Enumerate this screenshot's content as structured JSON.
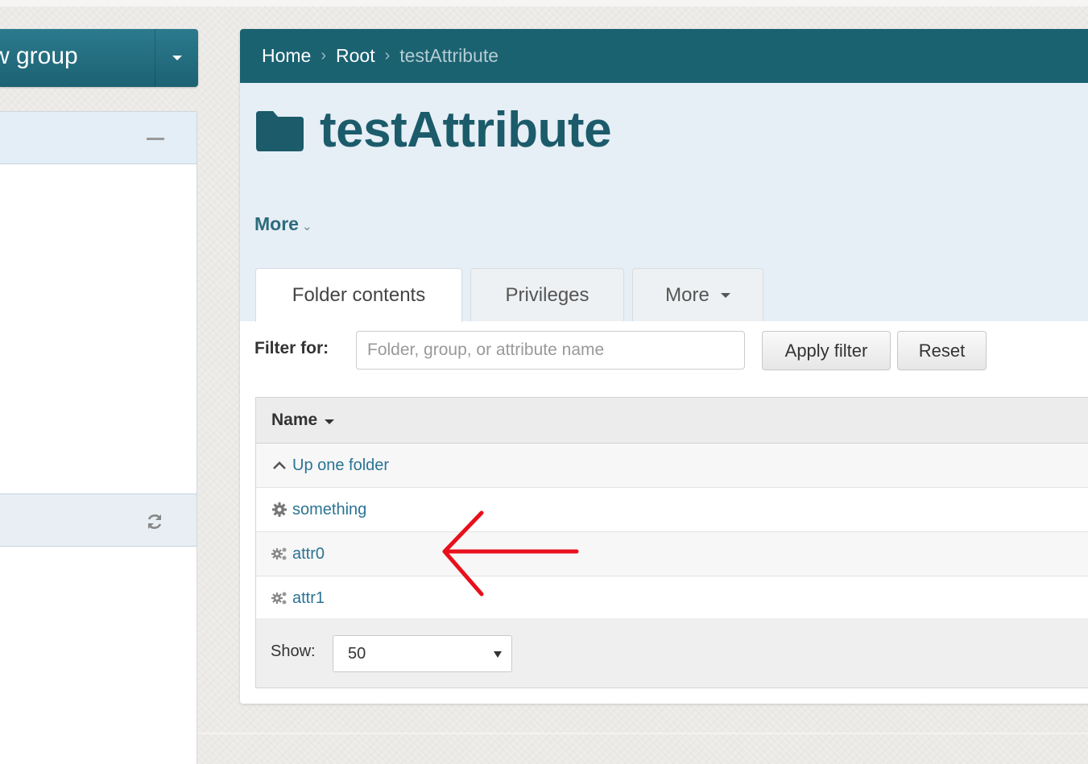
{
  "sidebar": {
    "new_group_label": "w group",
    "collapse_icon": "minus-icon",
    "refresh_icon": "refresh-icon"
  },
  "breadcrumb": {
    "items": [
      "Home",
      "Root"
    ],
    "current": "testAttribute",
    "separator": "›"
  },
  "header": {
    "title": "testAttribute",
    "folder_icon": "folder-icon",
    "more_label": "More",
    "more_chevron": "⌄"
  },
  "tabs": [
    {
      "label": "Folder contents",
      "active": true
    },
    {
      "label": "Privileges",
      "active": false
    },
    {
      "label": "More",
      "active": false
    }
  ],
  "filter": {
    "label": "Filter for:",
    "placeholder": "Folder, group, or attribute name",
    "value": "",
    "apply_label": "Apply filter",
    "reset_label": "Reset"
  },
  "table": {
    "header": "Name",
    "rows": [
      {
        "label": "Up one folder",
        "icon": "chevron-up-icon"
      },
      {
        "label": "something",
        "icon": "gear-icon"
      },
      {
        "label": "attr0",
        "icon": "gears-icon"
      },
      {
        "label": "attr1",
        "icon": "gears-icon"
      }
    ]
  },
  "pager": {
    "show_label": "Show:",
    "selected": "50"
  },
  "colors": {
    "accent": "#1b6271",
    "link": "#2a7394",
    "annotation": "#e8101c"
  }
}
